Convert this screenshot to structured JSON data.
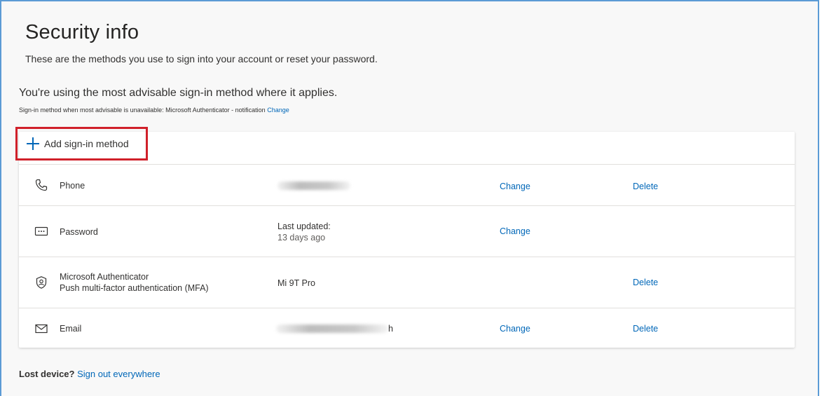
{
  "header": {
    "title": "Security info",
    "subtitle": "These are the methods you use to sign into your account or reset your password."
  },
  "advisable": {
    "message": "You're using the most advisable sign-in method where it applies.",
    "fallback_text": "Sign-in method when most advisable is unavailable: Microsoft Authenticator - notification",
    "fallback_change_label": "Change"
  },
  "add_method": {
    "label": "Add sign-in method",
    "icon": "plus-icon",
    "highlight_color": "#d0202a"
  },
  "methods": [
    {
      "icon": "phone-icon",
      "name": "Phone",
      "detail_line1": "",
      "detail_line2": "",
      "detail_redacted": true,
      "change_label": "Change",
      "delete_label": "Delete"
    },
    {
      "icon": "password-icon",
      "name": "Password",
      "detail_line1": "Last updated:",
      "detail_line2": "13 days ago",
      "change_label": "Change",
      "delete_label": ""
    },
    {
      "icon": "authenticator-icon",
      "name": "Microsoft Authenticator",
      "name_line2": "Push multi-factor authentication (MFA)",
      "detail_line1": "Mi 9T Pro",
      "change_label": "",
      "delete_label": "Delete"
    },
    {
      "icon": "email-icon",
      "name": "Email",
      "detail_redacted": true,
      "detail_tail": "h",
      "change_label": "Change",
      "delete_label": "Delete"
    }
  ],
  "footer": {
    "lost_device": "Lost device?",
    "sign_out_label": "Sign out everywhere"
  },
  "colors": {
    "link": "#0067b8",
    "frame_border": "#5b9bd5",
    "background": "#f8f8f8"
  }
}
